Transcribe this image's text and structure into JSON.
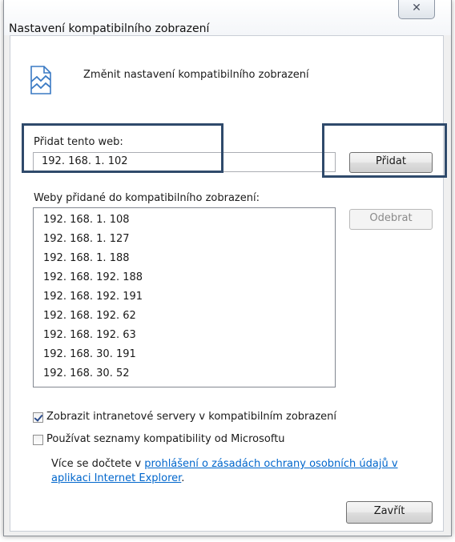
{
  "window": {
    "title": "Nastavení kompatibilního zobrazení",
    "close_glyph": "✕"
  },
  "header": {
    "icon": "compatibility-view-icon",
    "text": "Změnit nastavení kompatibilního zobrazení"
  },
  "add_site": {
    "label": "Přidat tento web:",
    "value": "192. 168. 1. 102",
    "add_button": "Přidat"
  },
  "sites": {
    "label": "Weby přidané do kompatibilního zobrazení:",
    "items": [
      "192. 168. 1. 108",
      "192. 168. 1. 127",
      "192. 168. 1. 188",
      "192. 168. 192. 188",
      "192. 168. 192. 191",
      "192. 168. 192. 62",
      "192. 168. 192. 63",
      "192. 168. 30. 191",
      "192. 168. 30. 52"
    ],
    "remove_button": "Odebrat"
  },
  "options": {
    "intranet": {
      "label": "Zobrazit intranetové servery v kompatibilním zobrazení",
      "checked": true
    },
    "microsoft_lists": {
      "label": "Používat seznamy kompatibility od Microsoftu",
      "checked": false
    }
  },
  "info": {
    "prefix": "Více se dočtete v ",
    "link_text_1": "prohlášení o zásadách ochrany osobních údajů v",
    "link_text_2": "aplikaci Internet Explorer",
    "suffix": "."
  },
  "footer": {
    "close_button": "Zavřít"
  },
  "colors": {
    "highlight_border": "#2f4a6b",
    "link": "#0066cc"
  }
}
